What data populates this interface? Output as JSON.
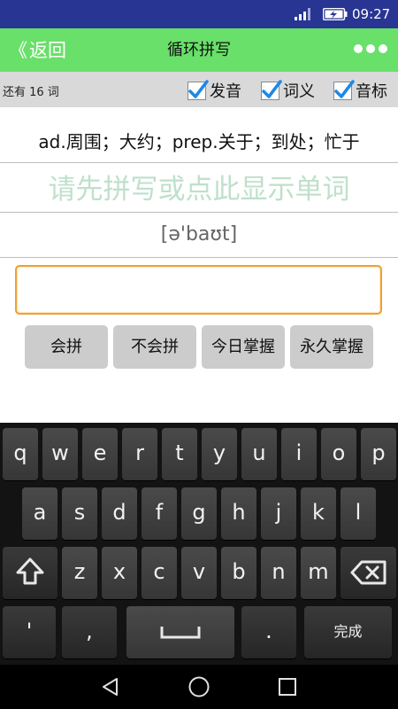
{
  "status_bar": {
    "time": "09:27"
  },
  "header": {
    "back_label": "返回",
    "back_chevron": "《",
    "title": "循环拼写",
    "more_icon": "more-dots-icon"
  },
  "options": {
    "remaining": "还有 16 词",
    "checkboxes": [
      {
        "label": "发音",
        "checked": true
      },
      {
        "label": "词义",
        "checked": true
      },
      {
        "label": "音标",
        "checked": true
      }
    ]
  },
  "word": {
    "meaning": "ad.周围；大约；prep.关于；到处；忙于",
    "hint": "请先拼写或点此显示单词",
    "phonetic": "[ə'baʊt]"
  },
  "input": {
    "value": "",
    "placeholder": ""
  },
  "actions": [
    "会拼",
    "不会拼",
    "今日掌握",
    "永久掌握"
  ],
  "keyboard": {
    "row1": [
      "q",
      "w",
      "e",
      "r",
      "t",
      "y",
      "u",
      "i",
      "o",
      "p"
    ],
    "row2": [
      "a",
      "s",
      "d",
      "f",
      "g",
      "h",
      "j",
      "k",
      "l"
    ],
    "row3": [
      "z",
      "x",
      "c",
      "v",
      "b",
      "n",
      "m"
    ],
    "row4": {
      "apostrophe": "'",
      "comma": ",",
      "period": ".",
      "done": "完成"
    }
  },
  "colors": {
    "status_bar": "#283593",
    "title_bar": "#69e069",
    "checkbox_accent": "#1e88e5",
    "input_border": "#f0a030",
    "hint_text": "#bfe0cc"
  }
}
